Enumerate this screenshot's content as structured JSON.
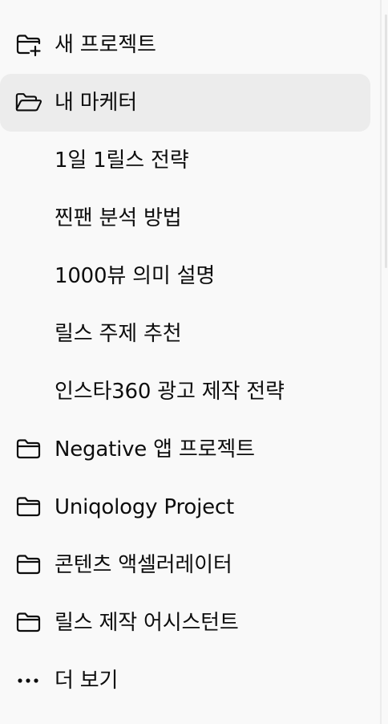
{
  "sidebar": {
    "new_project": {
      "label": "새 프로젝트",
      "icon": "folder-plus-icon"
    },
    "projects": [
      {
        "label": "내 마케터",
        "icon": "folder-open-icon",
        "active": true,
        "chats": [
          {
            "label": "1일 1릴스 전략"
          },
          {
            "label": "찐팬 분석 방법"
          },
          {
            "label": "1000뷰 의미 설명"
          },
          {
            "label": "릴스 주제 추천"
          },
          {
            "label": "인스타360 광고 제작 전략"
          }
        ]
      },
      {
        "label": "Negative 앱 프로젝트",
        "icon": "folder-icon"
      },
      {
        "label": "Uniqology Project",
        "icon": "folder-icon"
      },
      {
        "label": "콘텐츠 액셀러레이터",
        "icon": "folder-icon"
      },
      {
        "label": "릴스 제작 어시스턴트",
        "icon": "folder-icon"
      }
    ],
    "more": {
      "label": "더 보기",
      "icon": "ellipsis-icon"
    }
  },
  "colors": {
    "background": "#f9f9f9",
    "active_background": "#ececec",
    "text": "#0d0d0d"
  }
}
